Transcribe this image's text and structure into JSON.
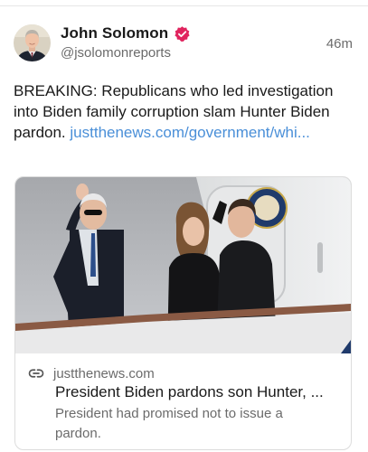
{
  "post": {
    "author": {
      "display_name": "John Solomon",
      "handle": "@jsolomonreports",
      "verified": true
    },
    "timestamp": "46m",
    "text": "BREAKING: Republicans who led investigation into Biden family corruption slam Hunter Biden pardon. ",
    "link_text": "justthenews.com/government/whi...",
    "link_card": {
      "domain": "justthenews.com",
      "title": "President Biden pardons son Hunter, ...",
      "description": "President had promised not to issue a pardon."
    }
  },
  "colors": {
    "link": "#4a8fd8",
    "verified_badge": "#e0245e",
    "secondary_text": "#6b6b6b"
  }
}
